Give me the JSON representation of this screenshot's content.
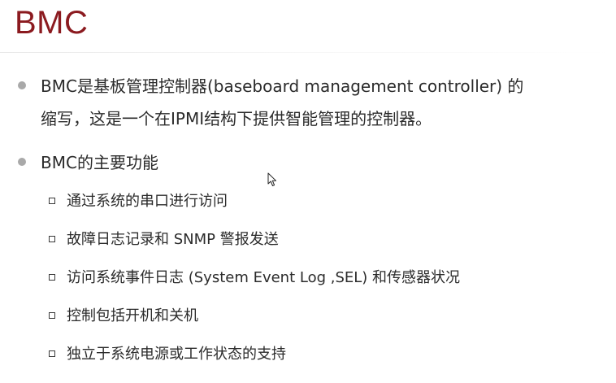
{
  "slide": {
    "title": "BMC",
    "bullets": [
      {
        "text": "BMC是基板管理控制器(baseboard management controller) 的\n缩写，这是一个在IPMI结构下提供智能管理的控制器。"
      },
      {
        "text": "BMC的主要功能",
        "subitems": [
          "通过系统的串口进行访问",
          "故障日志记录和 SNMP 警报发送",
          "访问系统事件日志 (System Event Log ,SEL) 和传感器状况",
          "控制包括开机和关机",
          "独立于系统电源或工作状态的支持"
        ]
      }
    ]
  },
  "colors": {
    "title": "#8b1a1f",
    "body_text": "#2b2b2b",
    "bullet_dot": "#a9a9a9"
  },
  "icons": {
    "cursor": "mouse-pointer-icon"
  }
}
